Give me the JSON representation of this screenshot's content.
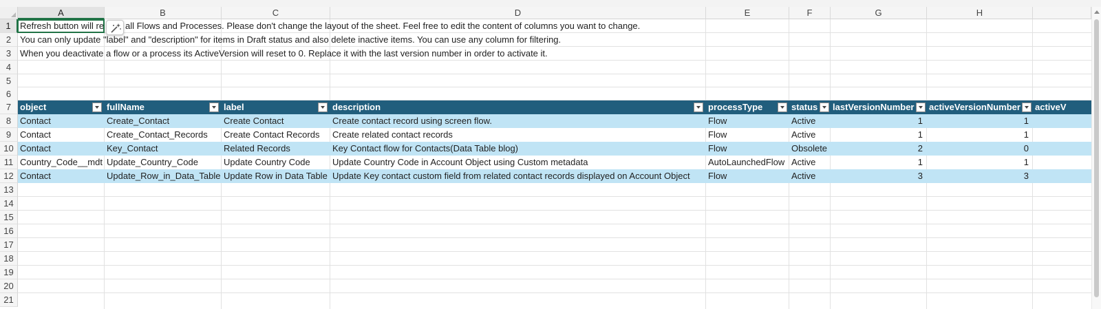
{
  "columns": [
    "A",
    "B",
    "C",
    "D",
    "E",
    "F",
    "G",
    "H"
  ],
  "rows": [
    "1",
    "2",
    "3",
    "4",
    "5",
    "6",
    "7",
    "8",
    "9",
    "10",
    "11",
    "12",
    "13",
    "14",
    "15",
    "16",
    "17",
    "18",
    "19",
    "20",
    "21"
  ],
  "notes": [
    "Refresh button will re",
    "all Flows and Processes. Please don't change the layout of the sheet. Feel free to edit the content of columns you want to change.",
    "You can only update \"label\" and \"description\" for items in Draft status and also delete inactive items. You can use any column for filtering.",
    "When you deactivate a flow or a process its ActiveVersion will reset to 0. Replace it with the last version number in order to activate it."
  ],
  "table": {
    "headers": [
      "object",
      "fullName",
      "label",
      "description",
      "processType",
      "status",
      "lastVersionNumber",
      "activeVersionNumber",
      "activeV"
    ],
    "rows": [
      [
        "Contact",
        "Create_Contact",
        "Create Contact",
        "Create contact record using screen flow.",
        "Flow",
        "Active",
        "1",
        "1"
      ],
      [
        "Contact",
        "Create_Contact_Records",
        "Create Contact Records",
        "Create related contact records",
        "Flow",
        "Active",
        "1",
        "1"
      ],
      [
        "Contact",
        "Key_Contact",
        "Related Records",
        "Key Contact flow for Contacts(Data Table blog)",
        "Flow",
        "Obsolete",
        "2",
        "0"
      ],
      [
        "Country_Code__mdt",
        "Update_Country_Code",
        "Update Country Code",
        "Update Country Code in Account Object using Custom metadata",
        "AutoLaunchedFlow",
        "Active",
        "1",
        "1"
      ],
      [
        "Contact",
        "Update_Row_in_Data_Table",
        "Update Row in Data Table",
        "Update Key contact custom field from related contact records displayed on Account Object",
        "Flow",
        "Active",
        "3",
        "3"
      ]
    ]
  },
  "selected_cell": "A1",
  "quick_button": {
    "icon": "magic-wand-icon"
  },
  "colors": {
    "table_header": "#215e7d",
    "band": "#c0e4f5",
    "selection": "#217346"
  }
}
